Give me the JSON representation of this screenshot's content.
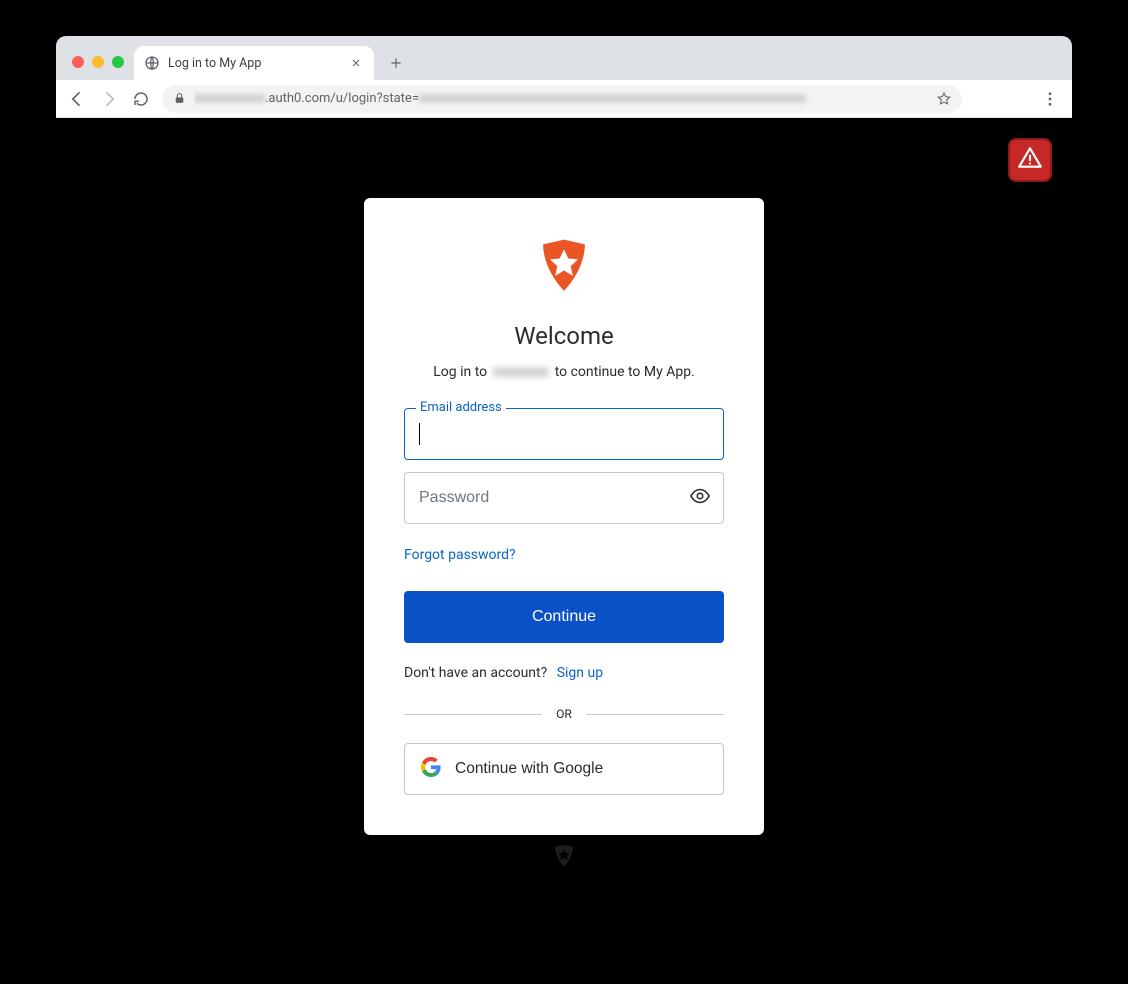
{
  "browser": {
    "tab_title": "Log in to My App",
    "url_visible": ".auth0.com/u/login?state=",
    "url_obscured_prefix": "xxxxxxxxxxx",
    "url_obscured_suffix": "xxxxxxxxxxxxxxxxxxxxxxxxxxxxxxxxxxxxxxxxxxxxxxxxxxxxxxxxxxxx"
  },
  "login": {
    "heading": "Welcome",
    "subtitle_prefix": "Log in to",
    "subtitle_tenant_obscured": "xxxxxxxx",
    "subtitle_suffix": "to continue to My App.",
    "email_label": "Email address",
    "email_value": "",
    "password_placeholder": "Password",
    "password_value": "",
    "forgot_label": "Forgot password?",
    "continue_label": "Continue",
    "signup_prompt": "Don't have an account?",
    "signup_link": "Sign up",
    "divider_label": "OR",
    "google_label": "Continue with Google"
  },
  "colors": {
    "accent_blue": "#0a50c7",
    "link_blue": "#0a66c2",
    "auth0_orange": "#eb5424",
    "alert_red": "#c62828"
  }
}
